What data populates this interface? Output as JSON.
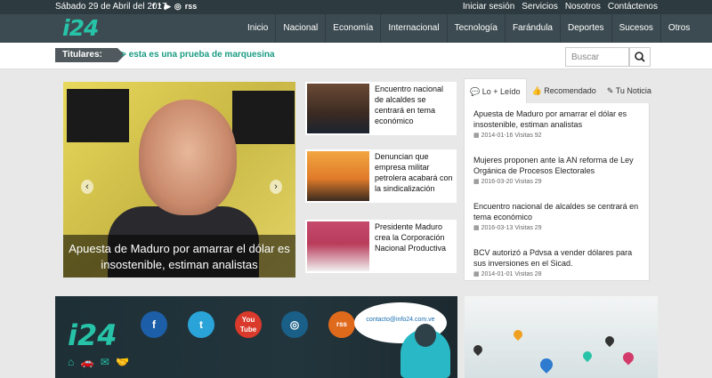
{
  "topbar": {
    "date": "Sábado 29 de Abril del 2017",
    "socials": [
      "f",
      "t",
      "▶",
      "◎",
      "rss"
    ],
    "links": [
      "Iniciar sesión",
      "Servicios",
      "Nosotros",
      "Contáctenos"
    ]
  },
  "logo": "i24",
  "nav": [
    "Inicio",
    "Nacional",
    "Economía",
    "Internacional",
    "Tecnología",
    "Farándula",
    "Deportes",
    "Sucesos",
    "Otros"
  ],
  "ticker": {
    "label": "Titulares:",
    "text": "> esta es una prueba de marquesina"
  },
  "search": {
    "placeholder": "Buscar"
  },
  "slider": {
    "caption": "Apuesta de Maduro por amarrar el dólar es insostenible, estiman analistas",
    "prev": "‹",
    "next": "›"
  },
  "stories": [
    {
      "title": "Encuentro nacional de alcaldes se centrará en tema económico"
    },
    {
      "title": "Denuncian que empresa militar petrolera acabará con la sindicalización"
    },
    {
      "title": "Presidente Maduro crea la Corporación Nacional Productiva"
    }
  ],
  "tabs": [
    {
      "label": "Lo + Leído",
      "icon": "comments-icon"
    },
    {
      "label": "Recomendado",
      "icon": "thumbs-up-icon"
    },
    {
      "label": "Tu Noticia",
      "icon": "edit-icon"
    }
  ],
  "most_read": [
    {
      "title": "Apuesta de Maduro por amarrar el dólar es insostenible, estiman analistas",
      "date": "2014-01-16",
      "visits": "Visitas 92"
    },
    {
      "title": "Mujeres proponen ante la AN reforma de Ley Orgánica de Procesos Electorales",
      "date": "2016-03-20",
      "visits": "Visitas 29"
    },
    {
      "title": "Encuentro nacional de alcaldes se centrará en tema económico",
      "date": "2016-03-13",
      "visits": "Visitas 29"
    },
    {
      "title": "BCV autorizó a Pdvsa a vender dólares para sus inversiones en el Sicad.",
      "date": "2014-01-01",
      "visits": "Visitas 28"
    }
  ],
  "banner": {
    "logo": "i24",
    "contact": "contacto@info24.com.ve",
    "icons": [
      "f",
      "t",
      "You Tube",
      "◎",
      "rss"
    ]
  },
  "colors": {
    "accent": "#27c3a8",
    "nav_bg": "#3c4b51",
    "topbar_bg": "#2d3a3f"
  }
}
